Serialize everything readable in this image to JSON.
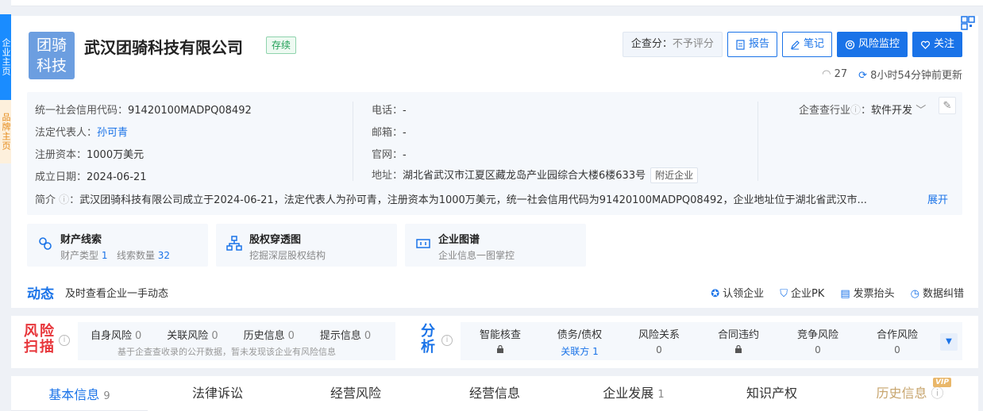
{
  "side_tabs": [
    "企业主页",
    "品牌主页"
  ],
  "company": {
    "logo_text_1": "团骑",
    "logo_text_2": "科技",
    "name": "武汉团骑科技有限公司",
    "status": "存续"
  },
  "actions": {
    "score_label": "企查分：",
    "score_value": "不予评分",
    "report": "报告",
    "note": "笔记",
    "monitor": "风险监控",
    "follow": "关注"
  },
  "meta": {
    "views": "27",
    "updated": "8小时54分钟前更新"
  },
  "info": {
    "credit_code_label": "统一社会信用代码：",
    "credit_code": "91420100MADPQ08492",
    "legal_rep_label": "法定代表人：",
    "legal_rep": "孙可青",
    "capital_label": "注册资本：",
    "capital": "1000万美元",
    "founded_label": "成立日期：",
    "founded": "2024-06-21",
    "phone_label": "电话：",
    "phone": "-",
    "email_label": "邮箱：",
    "email": "-",
    "website_label": "官网：",
    "website": "-",
    "address_label": "地址：",
    "address": "湖北省武汉市江夏区藏龙岛产业园综合大楼6楼633号",
    "nearby": "附近企业",
    "industry_label": "企查查行业",
    "industry": "软件开发",
    "intro_label": "简介",
    "intro": "武汉团骑科技有限公司成立于2024-06-21，法定代表人为孙可青，注册资本为1000万美元，统一社会信用代码为91420100MADPQ08492，企业地址位于湖北省武汉市...",
    "expand": "展开"
  },
  "features": [
    {
      "title": "财产线索",
      "sub_a": "财产类型",
      "sub_a_val": "1",
      "sub_b": "线索数量",
      "sub_b_val": "32"
    },
    {
      "title": "股权穿透图",
      "sub": "挖掘深层股权结构"
    },
    {
      "title": "企业图谱",
      "sub": "企业信息一图掌控"
    }
  ],
  "dynamics": {
    "title": "动态",
    "subtitle": "及时查看企业一手动态",
    "links": [
      "认领企业",
      "企业PK",
      "发票抬头",
      "数据纠错"
    ]
  },
  "risk_scan": {
    "logo_1": "风险",
    "logo_2": "扫描",
    "items": [
      {
        "label": "自身风险",
        "count": "0"
      },
      {
        "label": "关联风险",
        "count": "0"
      },
      {
        "label": "历史信息",
        "count": "0"
      },
      {
        "label": "提示信息",
        "count": "0"
      }
    ],
    "note": "基于企查查收录的公开数据，暂未发现该企业有风险信息"
  },
  "analysis": {
    "logo_1": "分",
    "logo_2": "析",
    "cols": [
      {
        "label": "智能核查",
        "value": ""
      },
      {
        "label": "债务/债权",
        "value": "关联方 1"
      },
      {
        "label": "风险关系",
        "value": "0"
      },
      {
        "label": "合同违约",
        "value": ""
      },
      {
        "label": "竞争风险",
        "value": "0"
      },
      {
        "label": "合作风险",
        "value": "0"
      }
    ]
  },
  "tabs": [
    {
      "label": "基本信息",
      "count": "9"
    },
    {
      "label": "法律诉讼",
      "count": ""
    },
    {
      "label": "经营风险",
      "count": ""
    },
    {
      "label": "经营信息",
      "count": ""
    },
    {
      "label": "企业发展",
      "count": "1"
    },
    {
      "label": "知识产权",
      "count": ""
    },
    {
      "label": "历史信息",
      "count": ""
    }
  ],
  "vip_badge": "VIP",
  "colors": {
    "accent": "#1a73e8",
    "risk_red": "#e7353a",
    "status_green": "#1f9e55"
  }
}
